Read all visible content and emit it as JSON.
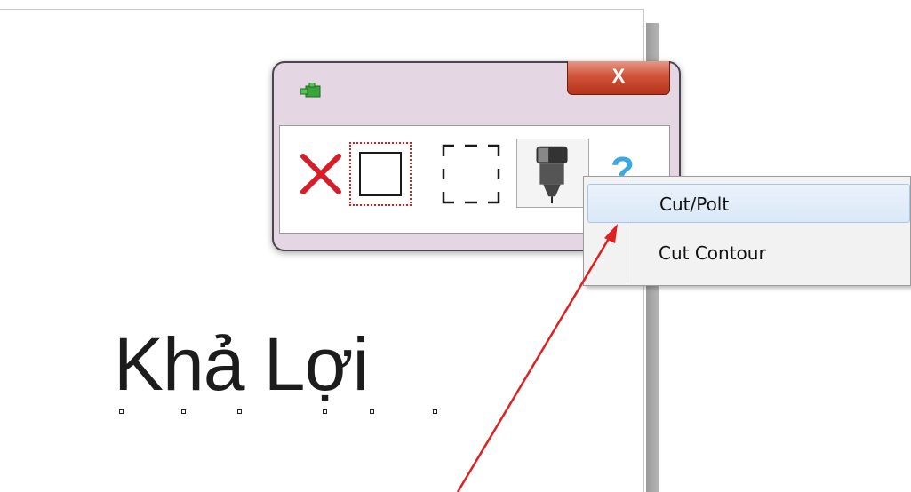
{
  "palette": {
    "close_label": "X",
    "tools": [
      {
        "icon": "delete-x-icon"
      },
      {
        "icon": "rectangle-frame-icon"
      },
      {
        "icon": "dashed-frame-icon"
      },
      {
        "icon": "cutter-plotter-icon"
      },
      {
        "icon": "help-question-icon",
        "label": "?"
      }
    ]
  },
  "context_menu": {
    "items": [
      {
        "label": "Cut/Polt",
        "highlighted": true
      },
      {
        "label": "Cut Contour",
        "highlighted": false
      }
    ]
  },
  "canvas": {
    "sample_text": "Khả Lợi"
  },
  "colors": {
    "window_frame": "#e4d6e2",
    "close_button": "#c9452d",
    "annotation_arrow": "#e02020",
    "menu_highlight": "#dbe8f7"
  }
}
